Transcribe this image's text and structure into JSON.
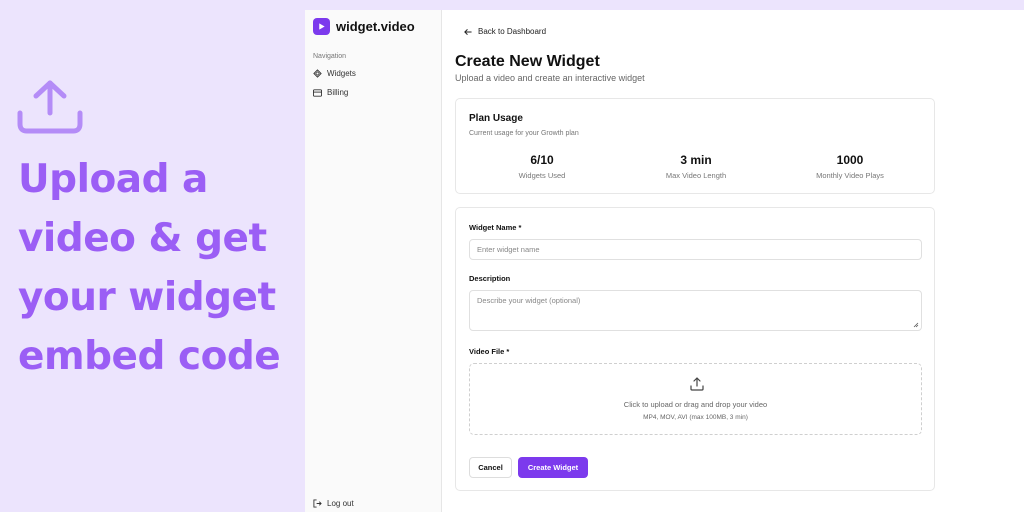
{
  "promo": {
    "lines": [
      "Upload a",
      "video & get",
      "your widget",
      "embed code"
    ],
    "icon": "upload-icon",
    "color": "#9b5ef5",
    "background": "#ece4fd"
  },
  "sidebar": {
    "brand_name": "widget.video",
    "brand_icon": "play-icon",
    "nav_heading": "Navigation",
    "items": [
      {
        "label": "Widgets",
        "icon": "widgets-icon"
      },
      {
        "label": "Billing",
        "icon": "credit-card-icon"
      }
    ],
    "logout_label": "Log out"
  },
  "main": {
    "back_label": "Back to Dashboard",
    "title": "Create New Widget",
    "subtitle": "Upload a video and create an interactive widget",
    "plan": {
      "title": "Plan Usage",
      "subtitle": "Current usage for your Growth plan",
      "stats": [
        {
          "value": "6/10",
          "label": "Widgets Used"
        },
        {
          "value": "3 min",
          "label": "Max Video Length"
        },
        {
          "value": "1000",
          "label": "Monthly Video Plays"
        }
      ]
    },
    "form": {
      "name_label": "Widget Name *",
      "name_placeholder": "Enter widget name",
      "description_label": "Description",
      "description_placeholder": "Describe your widget (optional)",
      "file_label": "Video File *",
      "upload_main": "Click to upload or drag and drop your video",
      "upload_sub": "MP4, MOV, AVI (max 100MB, 3 min)",
      "cancel_label": "Cancel",
      "create_label": "Create Widget"
    },
    "accent_color": "#7c3aed"
  }
}
